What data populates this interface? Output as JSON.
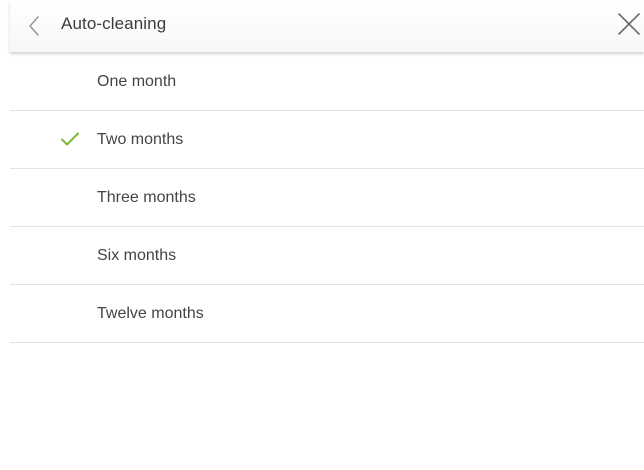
{
  "header": {
    "title": "Auto-cleaning",
    "back_icon": "chevron-left-icon",
    "close_icon": "close-icon"
  },
  "options": [
    {
      "label": "One month",
      "selected": false
    },
    {
      "label": "Two months",
      "selected": true
    },
    {
      "label": "Three months",
      "selected": false
    },
    {
      "label": "Six months",
      "selected": false
    },
    {
      "label": "Twelve months",
      "selected": false
    }
  ],
  "colors": {
    "accent_check": "#7cb93a",
    "divider": "#e4e4e4",
    "text": "#444444"
  }
}
